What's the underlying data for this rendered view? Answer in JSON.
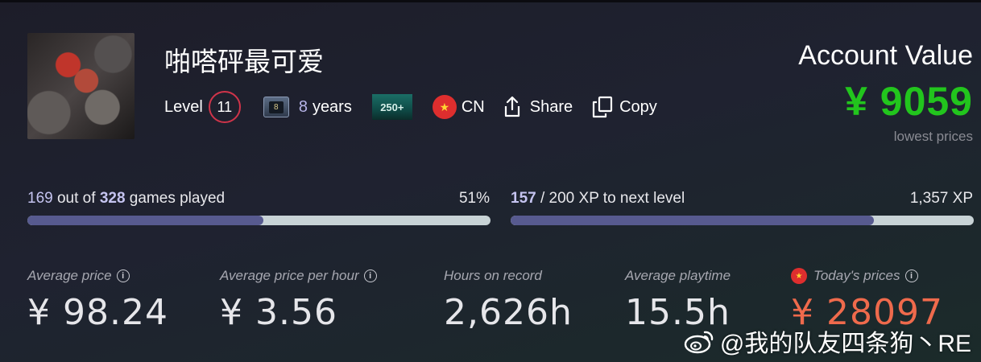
{
  "profile": {
    "username": "啪嗒砰最可爱",
    "level_label": "Level",
    "level": "11",
    "years_badge": "8",
    "years_num": "8",
    "years_label": "years",
    "games_badge": "250+",
    "country_code": "CN",
    "share_label": "Share",
    "copy_label": "Copy"
  },
  "account": {
    "title": "Account Value",
    "value": "¥ 9059",
    "note": "lowest prices",
    "value_color": "#22c51d"
  },
  "games_progress": {
    "played": "169",
    "out_of": "out of",
    "total": "328",
    "suffix": "games played",
    "percent_text": "51%",
    "fraction": 0.51
  },
  "xp_progress": {
    "current": "157",
    "rest": "/ 200 XP to next level",
    "total_text": "1,357 XP",
    "fraction": 0.785
  },
  "stats": [
    {
      "label": "Average price",
      "value": "¥ 98.24",
      "info": true
    },
    {
      "label": "Average price per hour",
      "value": "¥ 3.56",
      "info": true
    },
    {
      "label": "Hours on record",
      "value": "2,626h",
      "info": false
    },
    {
      "label": "Average playtime",
      "value": "15.5h",
      "info": false
    },
    {
      "label": "Today's prices",
      "value": "¥ 28097",
      "info": true,
      "value_color": "#ef6a4c"
    }
  ],
  "watermark": {
    "text": "@我的队友四条狗丶RE",
    "icon": "weibo-icon"
  },
  "colors": {
    "accent_purple": "#575a8f",
    "bar_track": "#c8d3d6",
    "level_ring": "#d0344a"
  }
}
